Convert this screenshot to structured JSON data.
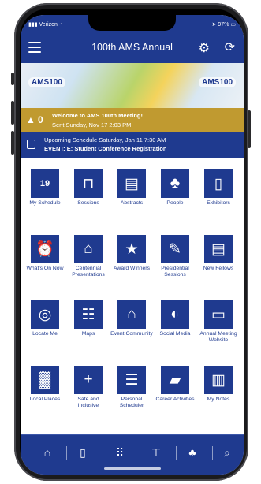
{
  "status_bar": {
    "carrier": "Verizon",
    "time": "3:31 PM",
    "battery": "97%"
  },
  "app_bar": {
    "title": "100th AMS Annual"
  },
  "banner": {
    "logo_left": "AMS100",
    "logo_right": "AMS100"
  },
  "alert": {
    "count": "0",
    "title": "Welcome to AMS 100th Meeting!",
    "subtitle": "Sent Sunday, Nov 17 2:03 PM"
  },
  "schedule": {
    "line1": "Upcoming Schedule Saturday, Jan 11 7:30 AM",
    "line2": "EVENT: E: Student Conference Registration"
  },
  "calendar_day": "19",
  "tiles": [
    {
      "label": "My Schedule",
      "icon": "calendar-icon"
    },
    {
      "label": "Sessions",
      "icon": "presentation-icon"
    },
    {
      "label": "Abstracts",
      "icon": "document-icon"
    },
    {
      "label": "People",
      "icon": "people-icon"
    },
    {
      "label": "Exhibitors",
      "icon": "phone-icon"
    },
    {
      "label": "What's On Now",
      "icon": "alarm-clock-icon"
    },
    {
      "label": "Centennial Presentations",
      "icon": "lamp-icon"
    },
    {
      "label": "Award Winners",
      "icon": "star-icon"
    },
    {
      "label": "Presidential Sessions",
      "icon": "pencil-icon"
    },
    {
      "label": "New Fellows",
      "icon": "document-icon"
    },
    {
      "label": "Locate Me",
      "icon": "target-icon"
    },
    {
      "label": "Maps",
      "icon": "grid-icon"
    },
    {
      "label": "Event Community",
      "icon": "house-icon"
    },
    {
      "label": "Social Media",
      "icon": "chat-bubble-icon"
    },
    {
      "label": "Annual Meeting Website",
      "icon": "monitor-icon"
    },
    {
      "label": "Local Places",
      "icon": "city-skyline-icon"
    },
    {
      "label": "Safe and Inclusive",
      "icon": "plus-icon"
    },
    {
      "label": "Personal Scheduler",
      "icon": "list-icon"
    },
    {
      "label": "Career Activities",
      "icon": "folder-icon"
    },
    {
      "label": "My Notes",
      "icon": "clipboard-icon"
    }
  ],
  "tab_bar": [
    "home-icon",
    "phone-icon",
    "grid-icon",
    "presentation-icon",
    "people-icon",
    "search-icon"
  ],
  "colors": {
    "primary": "#1f3a8f",
    "alert": "#c09a30",
    "background": "#ffffff"
  }
}
